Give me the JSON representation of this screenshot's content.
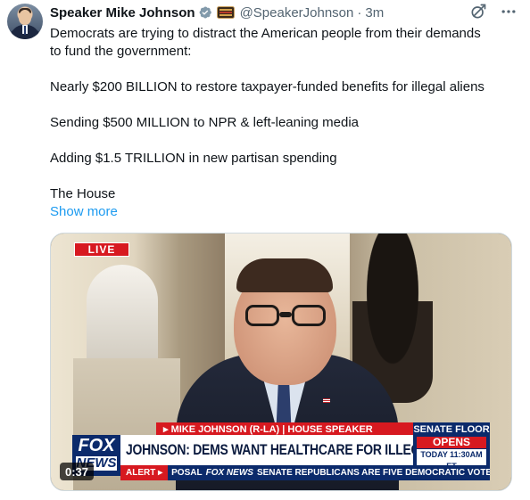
{
  "tweet": {
    "author_name": "Speaker Mike Johnson",
    "handle": "@SpeakerJohnson",
    "separator": "·",
    "time": "3m",
    "lines": [
      "Democrats are trying to distract the American people from their demands",
      "to fund the government:",
      "Nearly $200 BILLION to restore taxpayer-funded benefits for illegal aliens",
      "Sending $500 MILLION to NPR & left-leaning media",
      "Adding $1.5 TRILLION in new partisan spending",
      "The House"
    ],
    "show_more": "Show more"
  },
  "icons": {
    "verified": "verified-badge-icon",
    "affiliation": "flag-badge-icon",
    "grok": "grok-icon",
    "more": "more-icon"
  },
  "video": {
    "live_label": "LIVE",
    "lower_third_top": "▸ MIKE JOHNSON (R-LA) | HOUSE SPEAKER",
    "headline": "JOHNSON: DEMS WANT HEALTHCARE FOR ILLEGAL ALIENS",
    "network_logo_top": "FOX",
    "network_logo_bottom": "NEWS",
    "senate_line1": "SENATE FLOOR",
    "senate_line2": "OPENS",
    "senate_line3": "TODAY 11:30AM ET",
    "ticker_alert": "ALERT ▸",
    "ticker_left": "POSAL",
    "ticker_network": "FOX NEWS",
    "ticker_right": "SENATE REPUBLICANS ARE FIVE DEMOCRATIC VOTES SHORT",
    "duration": "0:37"
  },
  "colors": {
    "link": "#1d9bf0",
    "verified": "#829aab",
    "fox_red": "#d71920",
    "fox_blue": "#0b2a6b"
  }
}
